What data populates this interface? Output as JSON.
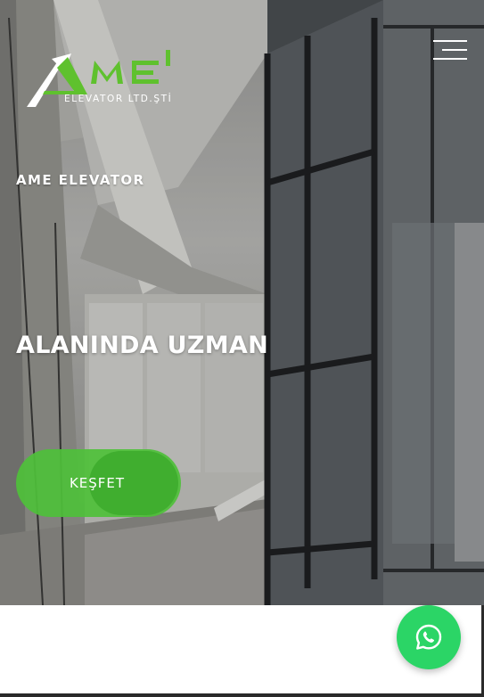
{
  "brand": {
    "logo_text": "AME",
    "logo_sub": "ELEVATOR LTD.ŞTİ",
    "accent": "#5fc12e"
  },
  "nav": {
    "menu_icon": "hamburger-menu-icon"
  },
  "hero": {
    "subtitle": "AME ELEVATOR",
    "headline": "ALANINDA UZMAN",
    "cta_label": "KEŞFET",
    "cta_color": "#4ec03a"
  },
  "floating": {
    "whatsapp_icon": "whatsapp-icon",
    "whatsapp_color": "#2bd566"
  }
}
